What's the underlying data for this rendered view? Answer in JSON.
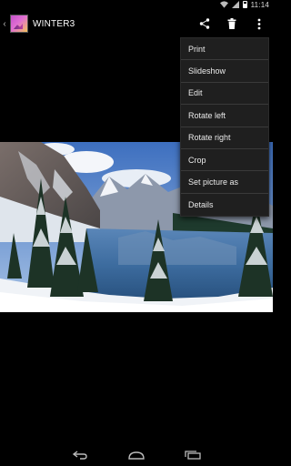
{
  "status_bar": {
    "time": "11:14",
    "icons": [
      "wifi-icon",
      "signal-icon",
      "battery-icon"
    ]
  },
  "action_bar": {
    "title": "WINTER3",
    "actions": [
      "share-icon",
      "delete-icon",
      "overflow-menu-icon"
    ]
  },
  "menu": {
    "items": [
      {
        "label": "Print"
      },
      {
        "label": "Slideshow"
      },
      {
        "label": "Edit"
      },
      {
        "label": "Rotate left"
      },
      {
        "label": "Rotate right"
      },
      {
        "label": "Crop"
      },
      {
        "label": "Set picture as"
      },
      {
        "label": "Details"
      }
    ]
  },
  "photo": {
    "subject": "winter-lake-landscape"
  },
  "nav_bar": {
    "buttons": [
      "back-icon",
      "home-icon",
      "recent-apps-icon"
    ]
  },
  "colors": {
    "background": "#000000",
    "menu_background": "#1f1f1f",
    "menu_divider": "#3a3a3a",
    "menu_text": "#eaeaea"
  }
}
